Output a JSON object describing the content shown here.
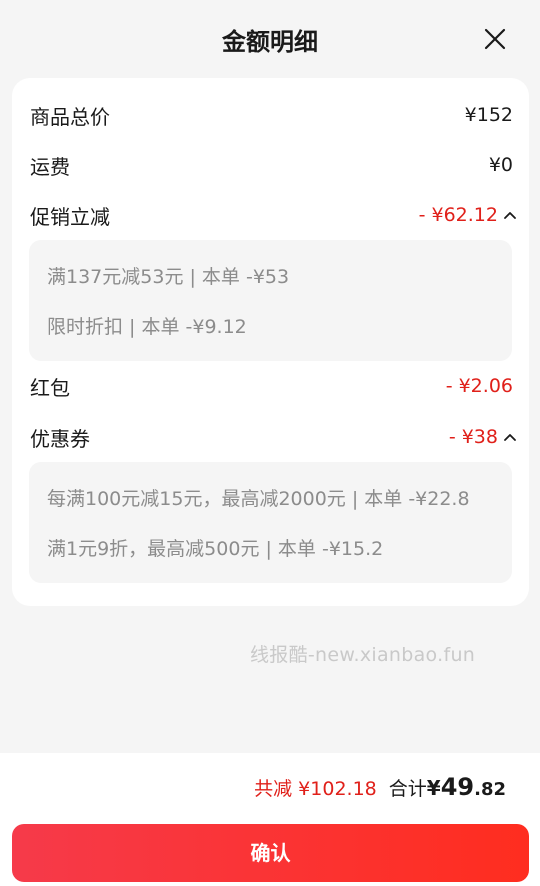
{
  "header": {
    "title": "金额明细"
  },
  "rows": {
    "goods_total": {
      "label": "商品总价",
      "amount": "¥152"
    },
    "shipping": {
      "label": "运费",
      "amount": "¥0"
    },
    "promotion": {
      "label": "促销立减",
      "amount": "- ¥62.12",
      "details": [
        "满137元减53元 | 本单 -¥53",
        "限时折扣 | 本单 -¥9.12"
      ]
    },
    "red_packet": {
      "label": "红包",
      "amount": "- ¥2.06"
    },
    "coupon": {
      "label": "优惠券",
      "amount": "- ¥38",
      "details": [
        "每满100元减15元，最高减2000元 | 本单 -¥22.8",
        "满1元9折，最高减500元 | 本单 -¥15.2"
      ]
    }
  },
  "watermark": "线报酷-new.xianbao.fun",
  "footer": {
    "saved_text": "共减 ¥102.18",
    "total_label": "合计 ",
    "total_currency": "¥",
    "total_integer": "49",
    "total_decimal": ".82",
    "confirm_label": "确认"
  },
  "colors": {
    "accent_red": "#e0201a",
    "button_gradient_start": "#f63a4a",
    "button_gradient_end": "#ff2d1f"
  },
  "icons": {
    "close": "close-icon",
    "expand": "chevron-up-icon"
  }
}
